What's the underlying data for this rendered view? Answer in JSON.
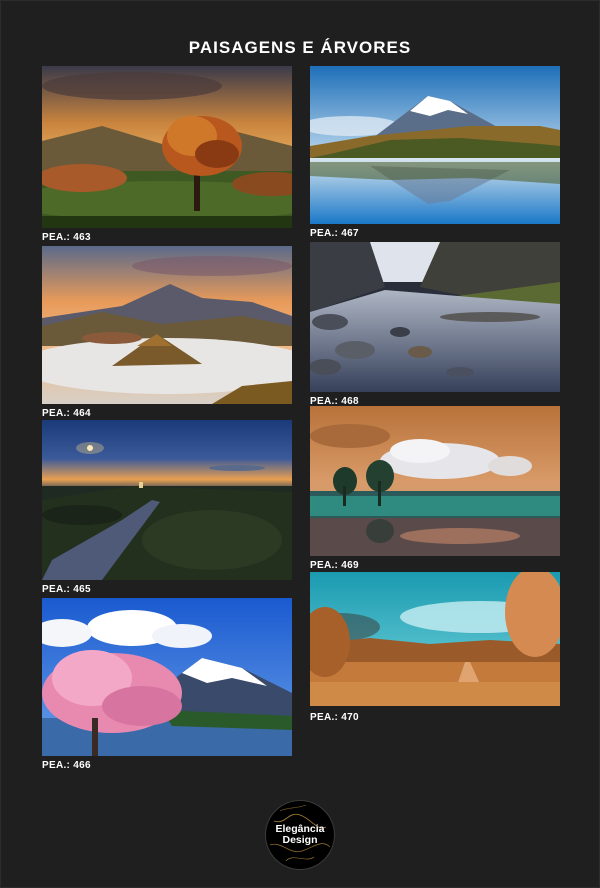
{
  "title": "PAISAGENS E ÁRVORES",
  "cards": [
    {
      "code": "PEA.: 463",
      "icon": "autumn-tree-photo"
    },
    {
      "code": "PEA.: 467",
      "icon": "snow-mountain-lake-photo"
    },
    {
      "code": "PEA.: 464",
      "icon": "volcano-sunrise-photo"
    },
    {
      "code": "PEA.: 468",
      "icon": "rocky-river-valley-photo"
    },
    {
      "code": "PEA.: 465",
      "icon": "night-road-moon-photo"
    },
    {
      "code": "PEA.: 469",
      "icon": "cypress-lake-clouds-photo"
    },
    {
      "code": "PEA.: 466",
      "icon": "cherry-blossom-mountain-photo"
    },
    {
      "code": "PEA.: 470",
      "icon": "autumn-path-photo"
    }
  ],
  "logo": {
    "line1": "Elegância",
    "line2": "Design"
  },
  "colors": {
    "background": "#1f1f1f",
    "text": "#ffffff"
  }
}
